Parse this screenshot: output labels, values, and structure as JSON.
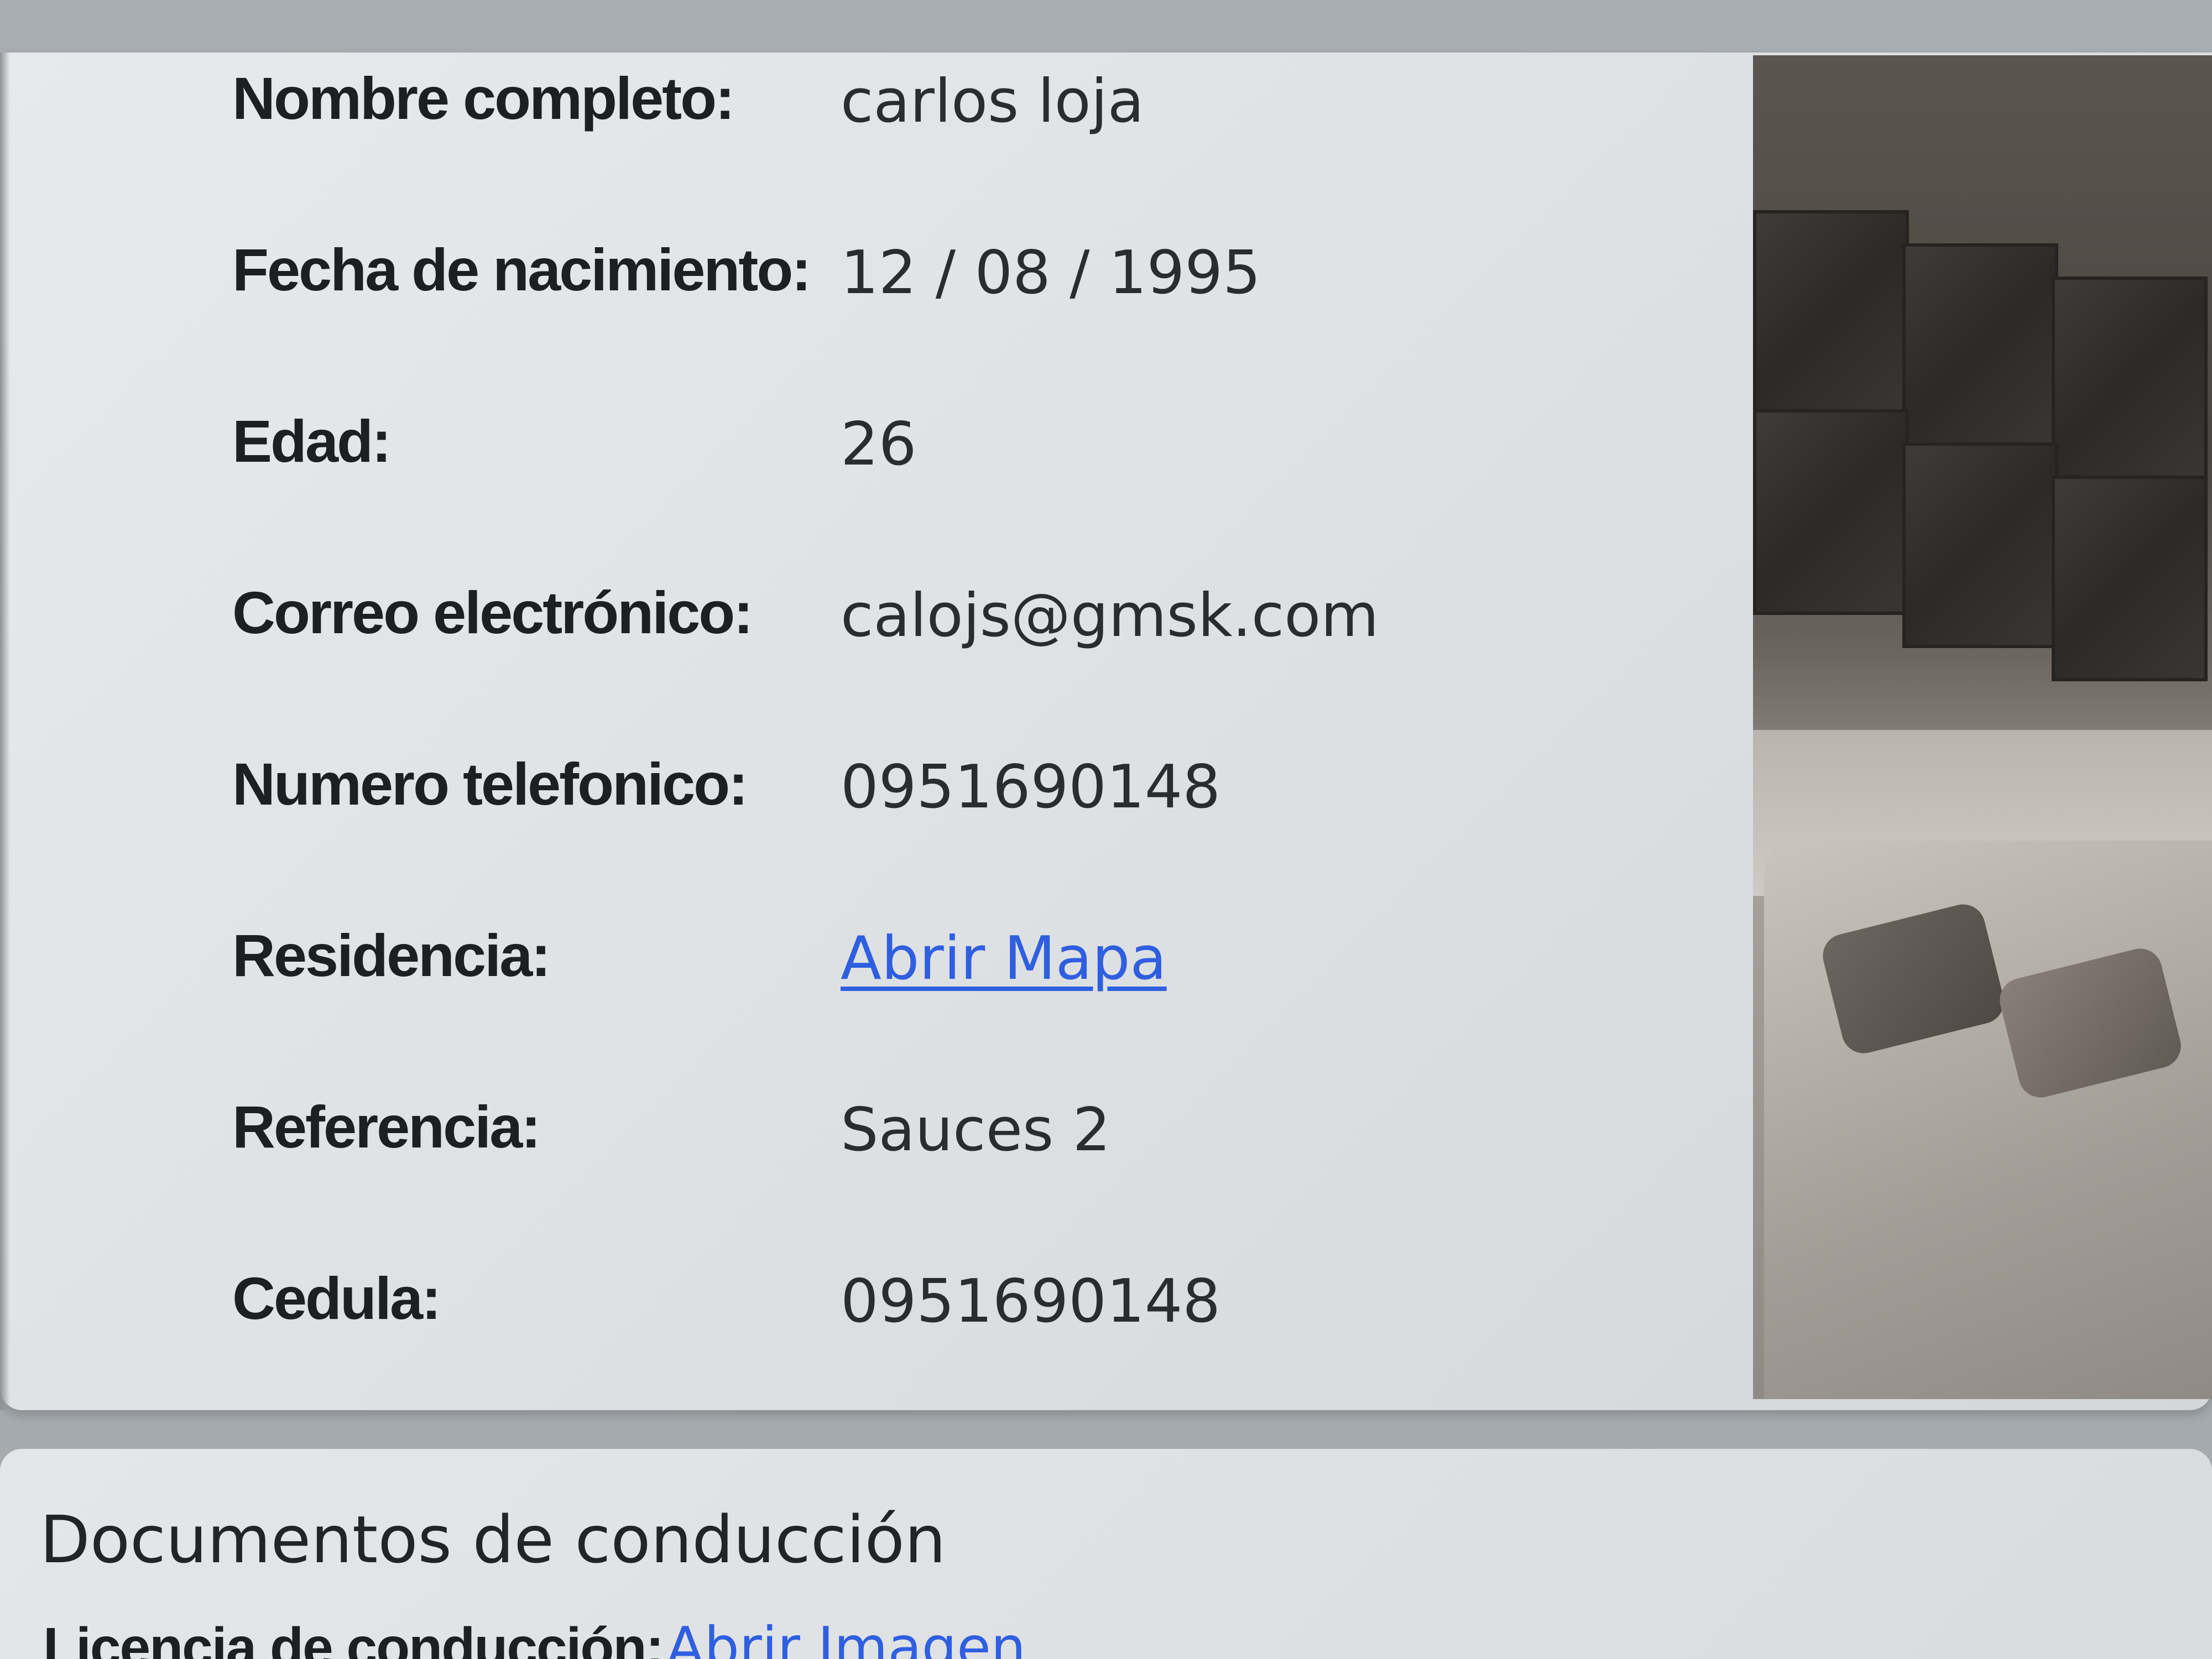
{
  "profile": {
    "fields": [
      {
        "label": "Nombre completo:",
        "value": "carlos loja"
      },
      {
        "label": "Fecha de nacimiento:",
        "value": "12 / 08 / 1995"
      },
      {
        "label": "Edad:",
        "value": "26"
      },
      {
        "label": "Correo electrónico:",
        "value": "calojs@gmsk.com"
      },
      {
        "label": "Numero telefonico:",
        "value": "0951690148"
      },
      {
        "label": "Residencia:",
        "value": "Abrir Mapa"
      },
      {
        "label": "Referencia:",
        "value": "Sauces 2"
      },
      {
        "label": "Cedula:",
        "value": "0951690148"
      }
    ]
  },
  "documents": {
    "title": "Documentos de conducción",
    "license_label": "Licencia de conducción:",
    "license_link": "Abrir Imagen"
  },
  "colors": {
    "link": "#2f5fe0",
    "label_text": "#1d1f22",
    "value_text": "#2a2c2f",
    "card_background": "#e2e4e7"
  }
}
